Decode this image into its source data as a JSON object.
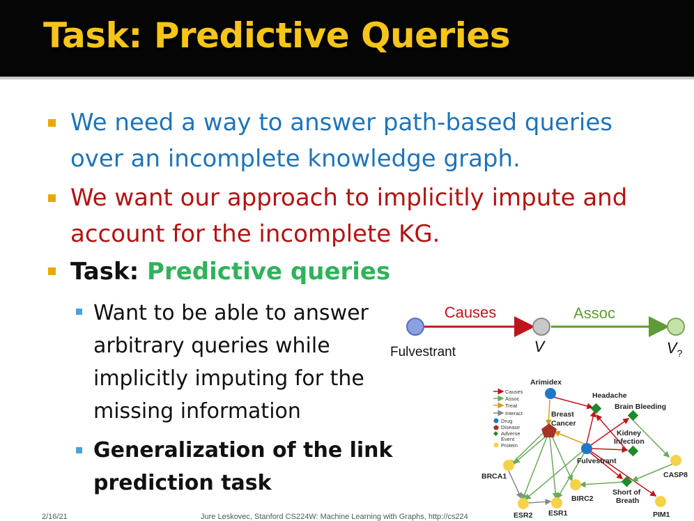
{
  "title": "Task: Predictive Queries",
  "bullets": {
    "b1_line1": "We need a way to answer path-based queries",
    "b1_line2": "over an incomplete knowledge graph.",
    "b2_line1": "We want our approach to implicitly impute and",
    "b2_line2": "account for the incomplete KG.",
    "b3_prefix": "Task: ",
    "b3_highlight": "Predictive queries"
  },
  "subbullets": {
    "s1_line1": "Want to be able to answer",
    "s1_line2": "arbitrary queries while",
    "s1_line3": "implicitly imputing for the",
    "s1_line4": "missing information",
    "s2_line1": "Generalization of the link",
    "s2_line2": "prediction task"
  },
  "path_diagram": {
    "rel1": "Causes",
    "rel2": "Assoc",
    "anchor": "Fulvestrant",
    "var": "V",
    "target_base": "V",
    "target_sub": "?",
    "colors": {
      "causes": "#c0141c",
      "assoc": "#5e9a37",
      "anchor_node": "#8aa0e0",
      "var_node": "#c8c8c8",
      "target_node": "#c4e3a8"
    }
  },
  "kg": {
    "legend": [
      "Causes",
      "Assoc",
      "Treat",
      "Interact",
      "Drug",
      "Disease",
      "Adverse",
      "Event",
      "Protein"
    ],
    "nodes": {
      "arimidex": "Arimidex",
      "headache": "Headache",
      "brain_bleeding": "Brain Bleeding",
      "breast": "Breast",
      "cancer": "Cancer",
      "kidney": "Kidney",
      "infection": "Infection",
      "fulvestrant": "Fulvestrant",
      "casp8": "CASP8",
      "brca1": "BRCA1",
      "birc2": "BIRC2",
      "short": "Short of",
      "breath": "Breath",
      "esr2": "ESR2",
      "esr1": "ESR1",
      "pim1": "PIM1"
    },
    "colors": {
      "causes": "#c0141c",
      "assoc": "#6aaa5a",
      "treat": "#d4a017",
      "interact": "#888888",
      "drug": "#1f77c8",
      "disease": "#a5332a",
      "adverse": "#1f8a2a",
      "protein": "#f5d24a"
    }
  },
  "footer": {
    "date": "2/16/21",
    "credit": "Jure Leskovec, Stanford CS224W: Machine Learning with Graphs, http://cs224"
  }
}
